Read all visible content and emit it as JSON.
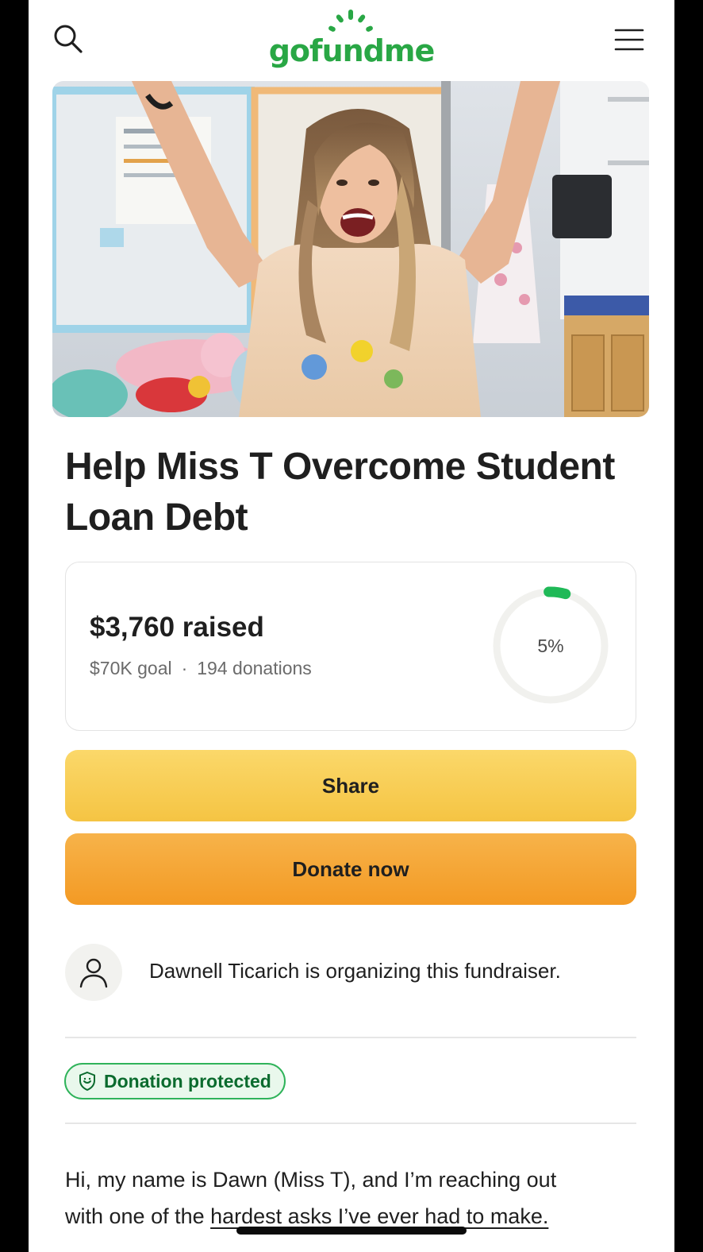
{
  "header": {
    "logo_text": "gofundme",
    "search_icon": "search-icon",
    "menu_icon": "hamburger-menu-icon"
  },
  "hero": {
    "subject": "woman-cheering-in-classroom-photo"
  },
  "campaign": {
    "title": "Help Miss T Overcome Student Loan Debt"
  },
  "progress": {
    "raised_label": "$3,760 raised",
    "goal_label": "$70K goal",
    "separator": "·",
    "donations_label": "194 donations",
    "percent_label": "5%",
    "percent_value": 0.05,
    "ring_color": "#1fb957",
    "track_color": "#f1f1ee"
  },
  "actions": {
    "share_label": "Share",
    "donate_label": "Donate now"
  },
  "organizer": {
    "text": "Dawnell Ticarich is organizing this fundraiser.",
    "avatar_icon": "user-icon"
  },
  "badge": {
    "label": "Donation protected",
    "icon": "shield-icon"
  },
  "story": {
    "line1": "Hi, my name is Dawn (Miss T), and I’m reaching out",
    "line2_a": "with one of the ",
    "line2_b": "hardest asks I’ve ever had to make."
  },
  "colors": {
    "brand": "#29a745",
    "share_button": "#f5c443",
    "donate_button": "#f39a24"
  }
}
